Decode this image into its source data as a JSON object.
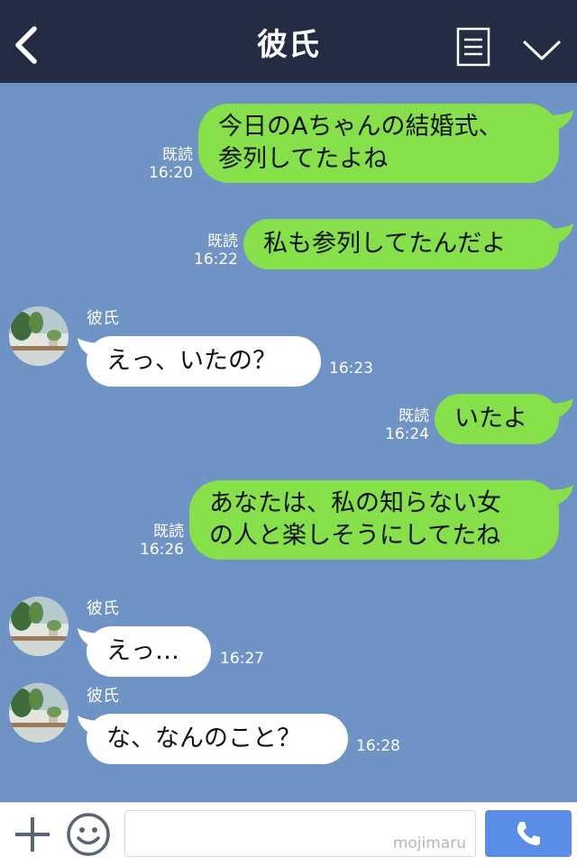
{
  "header": {
    "title": "彼氏",
    "back_icon": "chevron-left-icon",
    "menu_icon": "menu-list-icon",
    "collapse_icon": "chevron-down-icon"
  },
  "read_label": "既読",
  "messages": [
    {
      "side": "sent",
      "lines": [
        "今日のAちゃんの結婚式、",
        "参列してたよね"
      ],
      "read": "既読",
      "time": "16:20"
    },
    {
      "side": "sent",
      "lines": [
        "私も参列してたんだよ"
      ],
      "read": "既読",
      "time": "16:22"
    },
    {
      "side": "received",
      "sender": "彼氏",
      "lines": [
        "えっ、いたの？"
      ],
      "time": "16:23"
    },
    {
      "side": "sent",
      "lines": [
        "いたよ"
      ],
      "read": "既読",
      "time": "16:24"
    },
    {
      "side": "sent",
      "lines": [
        "あなたは、私の知らない女",
        "の人と楽しそうにしてたね"
      ],
      "read": "既読",
      "time": "16:26"
    },
    {
      "side": "received",
      "sender": "彼氏",
      "lines": [
        "えっ…"
      ],
      "time": "16:27"
    },
    {
      "side": "received",
      "sender": "彼氏",
      "lines": [
        "な、なんのこと？"
      ],
      "time": "16:28"
    }
  ],
  "composer": {
    "plus_icon": "plus-icon",
    "emoji_icon": "smile-icon",
    "input_value": "",
    "watermark": "mojimaru",
    "send_icon": "phone-icon"
  },
  "colors": {
    "header_bg": "#232c42",
    "chat_bg": "#7093c6",
    "sent_bubble": "#85e049",
    "received_bubble": "#ffffff",
    "send_button": "#5a8ee6"
  }
}
